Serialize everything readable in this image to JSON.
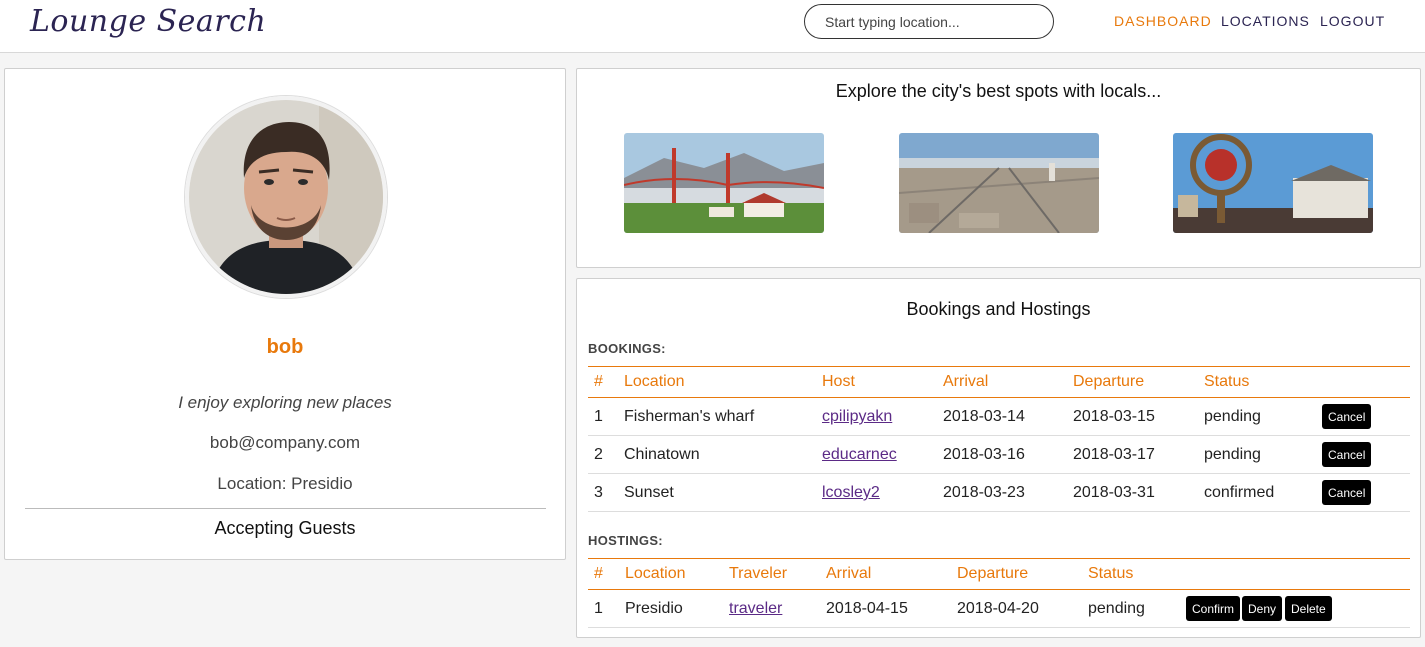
{
  "navbar": {
    "brand": "Lounge Search",
    "search_placeholder": "Start typing location...",
    "links": [
      "DASHBOARD",
      "LOCATIONS",
      "LOGOUT"
    ],
    "active_link": "DASHBOARD"
  },
  "profile": {
    "name": "bob",
    "bio": "I enjoy exploring new places",
    "email": "bob@company.com",
    "location": "Location: Presidio",
    "guests_status": "Accepting Guests"
  },
  "explore": {
    "title": "Explore the city's best spots with locals..."
  },
  "bookings_panel": {
    "title": "Bookings and Hostings",
    "bookings": {
      "label": "BOOKINGS:",
      "columns": [
        "#",
        "Location",
        "Host",
        "Arrival",
        "Departure",
        "Status"
      ],
      "rows": [
        {
          "num": "1",
          "location": "Fisherman's wharf",
          "host": "cpilipyakn",
          "arrival": "2018-03-14",
          "departure": "2018-03-15",
          "status": "pending",
          "action": "Cancel"
        },
        {
          "num": "2",
          "location": "Chinatown",
          "host": "educarnec",
          "arrival": "2018-03-16",
          "departure": "2018-03-17",
          "status": "pending",
          "action": "Cancel"
        },
        {
          "num": "3",
          "location": "Sunset",
          "host": "lcosley2",
          "arrival": "2018-03-23",
          "departure": "2018-03-31",
          "status": "confirmed",
          "action": "Cancel"
        }
      ]
    },
    "hostings": {
      "label": "HOSTINGS:",
      "columns": [
        "#",
        "Location",
        "Traveler",
        "Arrival",
        "Departure",
        "Status"
      ],
      "rows": [
        {
          "num": "1",
          "location": "Presidio",
          "traveler": "traveler",
          "arrival": "2018-04-15",
          "departure": "2018-04-20",
          "status": "pending",
          "actions": [
            "Confirm",
            "Deny",
            "Delete"
          ]
        }
      ]
    }
  },
  "colors": {
    "accent": "#e8790c",
    "brand": "#2b2452",
    "link": "#5b2a86"
  }
}
